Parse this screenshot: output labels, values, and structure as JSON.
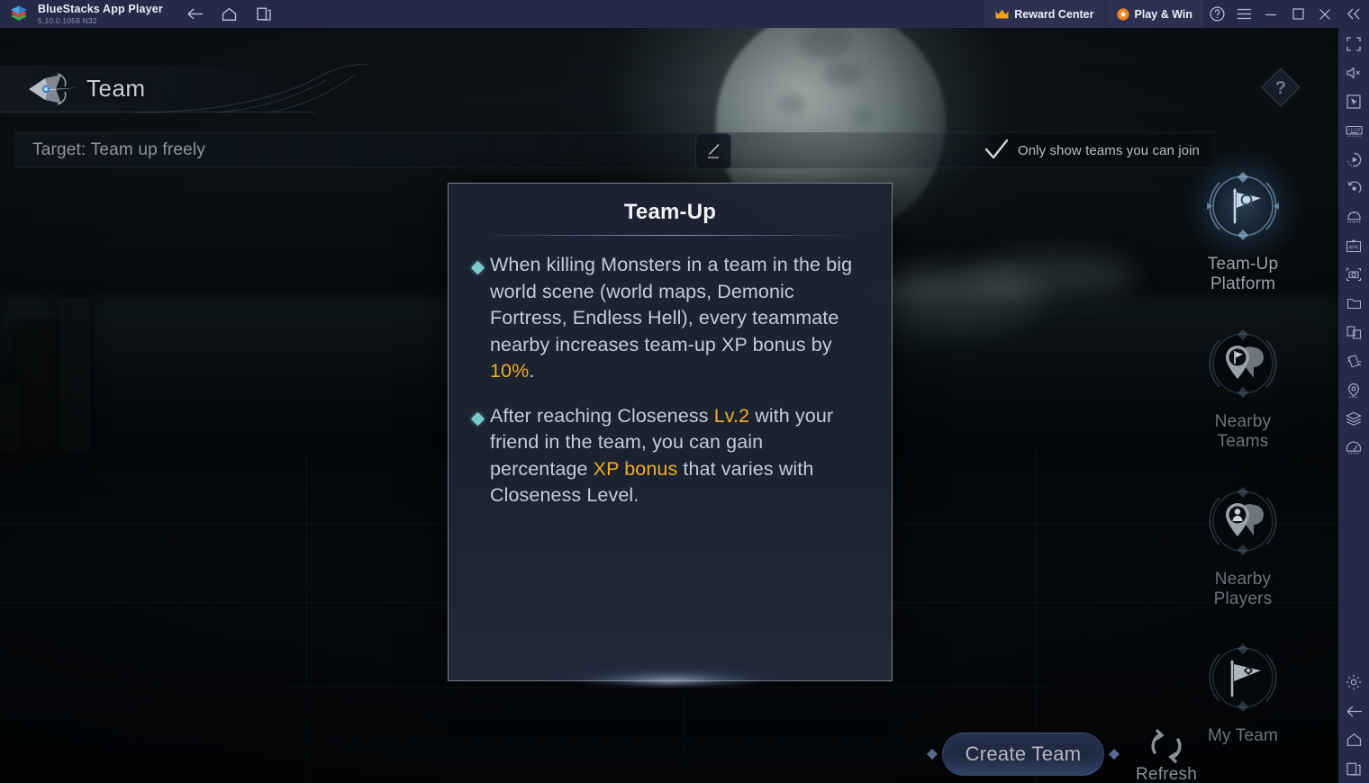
{
  "titlebar": {
    "app_name": "BlueStacks App Player",
    "version": "5.10.0.1058  N32",
    "logo_icon": "bluestacks-logo-icon",
    "nav": [
      {
        "name": "back",
        "label": "Back",
        "icon": "arrow-left-icon"
      },
      {
        "name": "home",
        "label": "Home",
        "icon": "home-icon"
      },
      {
        "name": "recents",
        "label": "Recents",
        "icon": "recents-icon"
      }
    ],
    "reward_center": {
      "label": "Reward Center",
      "icon": "crown-icon"
    },
    "play_and_win": {
      "label": "Play & Win",
      "icon": "star-badge-icon"
    },
    "controls": [
      {
        "name": "help",
        "icon": "question-circle-icon"
      },
      {
        "name": "menu",
        "icon": "hamburger-menu-icon"
      },
      {
        "name": "minimize",
        "icon": "minimize-icon"
      },
      {
        "name": "maximize",
        "icon": "maximize-icon"
      },
      {
        "name": "close",
        "icon": "close-icon"
      },
      {
        "name": "collapse-sidebar",
        "icon": "chevron-double-left-icon"
      }
    ]
  },
  "game": {
    "header_title": "Team",
    "header_icon": "team-crest-icon",
    "help_button": {
      "label": "?",
      "icon": "help-diamond-icon"
    },
    "target_bar": {
      "text": "Target: Team up freely",
      "edit_icon": "pencil-edit-icon"
    },
    "join_filter": {
      "label": "Only show teams you can join",
      "icon": "checkmark-icon",
      "checked": true
    },
    "side_menu": [
      {
        "label_line1": "Team-Up",
        "label_line2": "Platform",
        "icon": "flag-search-icon",
        "active": true
      },
      {
        "label_line1": "Nearby",
        "label_line2": "Teams",
        "icon": "map-pin-flag-icon",
        "active": false
      },
      {
        "label_line1": "Nearby",
        "label_line2": "Players",
        "icon": "map-pin-person-icon",
        "active": false
      },
      {
        "label_line1": "My Team",
        "label_line2": "",
        "icon": "flag-gem-icon",
        "active": false
      }
    ],
    "create_team_button": {
      "label": "Create Team",
      "gem_icon": "gem-diamond-icon"
    },
    "refresh_button": {
      "label": "Refresh",
      "icon": "refresh-circular-icon"
    }
  },
  "dialog": {
    "title": "Team-Up",
    "bullet_icon": "diamond-bullet-icon",
    "bullets": [
      {
        "segments": [
          {
            "text": "When killing Monsters in a team in the big world scene (world maps, Demonic Fortress, Endless Hell), every teammate nearby increases team-up XP bonus by ",
            "highlight": false
          },
          {
            "text": "10%",
            "highlight": true
          },
          {
            "text": ".",
            "highlight": false
          }
        ]
      },
      {
        "segments": [
          {
            "text": "After reaching Closeness ",
            "highlight": false
          },
          {
            "text": "Lv.2",
            "highlight": true
          },
          {
            "text": " with your friend in the team, you can gain percentage ",
            "highlight": false
          },
          {
            "text": "XP bonus",
            "highlight": true
          },
          {
            "text": " that varies with Closeness Level.",
            "highlight": false
          }
        ]
      }
    ]
  },
  "toolbar": {
    "items": [
      {
        "name": "fullscreen",
        "icon": "fullscreen-icon"
      },
      {
        "name": "mute",
        "icon": "speaker-mute-icon"
      },
      {
        "name": "cursor",
        "icon": "cursor-pointer-icon"
      },
      {
        "name": "keyboard-controls",
        "icon": "keyboard-icon"
      },
      {
        "name": "macro-record",
        "icon": "play-record-icon"
      },
      {
        "name": "rotate",
        "icon": "rotate-icon"
      },
      {
        "name": "gamepad",
        "icon": "gamepad-icon"
      },
      {
        "name": "install-apk",
        "icon": "apk-install-icon"
      },
      {
        "name": "screenshot",
        "icon": "camera-icon"
      },
      {
        "name": "media-manager",
        "icon": "folder-icon"
      },
      {
        "name": "multi-instance",
        "icon": "multi-instance-icon"
      },
      {
        "name": "shake",
        "icon": "shake-icon"
      },
      {
        "name": "location",
        "icon": "location-pin-icon"
      },
      {
        "name": "layers",
        "icon": "layers-icon"
      },
      {
        "name": "performance",
        "icon": "speedometer-icon"
      }
    ],
    "bottom_items": [
      {
        "name": "settings",
        "icon": "gear-icon"
      },
      {
        "name": "back",
        "icon": "arrow-left-icon"
      },
      {
        "name": "home",
        "icon": "home-icon"
      },
      {
        "name": "recents",
        "icon": "recents-icon"
      }
    ]
  },
  "colors": {
    "titlebar_bg": "#252a48",
    "accent_orange": "#f0ad29",
    "dialog_bg": "#1c2332",
    "bullet_teal": "#79c8cc"
  }
}
